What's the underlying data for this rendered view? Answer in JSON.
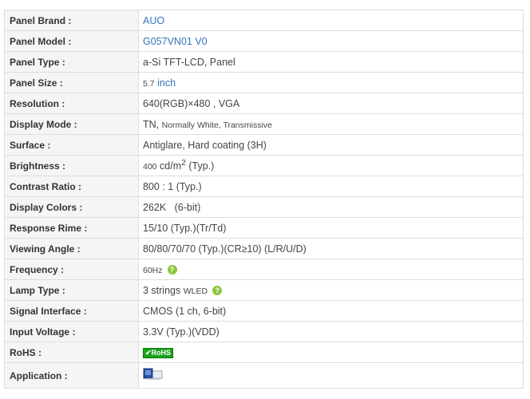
{
  "colors": {
    "link": "#3574b8",
    "help_badge": "#8dc63f",
    "rohs_badge": "#1aa01a"
  },
  "specs": [
    {
      "label": "Panel Brand :",
      "value": "AUO"
    },
    {
      "label": "Panel Model :",
      "value": "G057VN01 V0"
    },
    {
      "label": "Panel Type :",
      "value": "a-Si TFT-LCD, Panel"
    },
    {
      "label": "Panel Size :",
      "value_num": "5.7",
      "value_unit": "inch"
    },
    {
      "label": "Resolution :",
      "value": "640(RGB)×480 , VGA"
    },
    {
      "label": "Display Mode :",
      "value_main": "TN,",
      "value_rest": "Normally White, Transmissive"
    },
    {
      "label": "Surface :",
      "value": "Antiglare, Hard coating (3H)"
    },
    {
      "label": "Brightness :",
      "value_num": "400",
      "value_unit": "cd/m",
      "value_sup": "2",
      "value_note": "(Typ.)"
    },
    {
      "label": "Contrast Ratio :",
      "value": "800 : 1 (Typ.)"
    },
    {
      "label": "Display Colors :",
      "value": "262K   (6-bit)"
    },
    {
      "label": "Response Rime :",
      "value": "15/10 (Typ.)(Tr/Td)"
    },
    {
      "label": "Viewing Angle :",
      "value": "80/80/70/70 (Typ.)(CR≥10) (L/R/U/D)"
    },
    {
      "label": "Frequency :",
      "value": "60Hz",
      "help_icon": "question-icon"
    },
    {
      "label": "Lamp Type :",
      "value_main": "3 strings",
      "value_rest": "WLED",
      "help_icon": "question-icon"
    },
    {
      "label": "Signal Interface :",
      "value": "CMOS (1 ch, 6-bit)"
    },
    {
      "label": "Input Voltage :",
      "value": "3.3V (Typ.)(VDD)"
    },
    {
      "label": "RoHS :",
      "badge": "✔RoHS"
    },
    {
      "label": "Application :",
      "icon": "application-device-icon"
    }
  ]
}
